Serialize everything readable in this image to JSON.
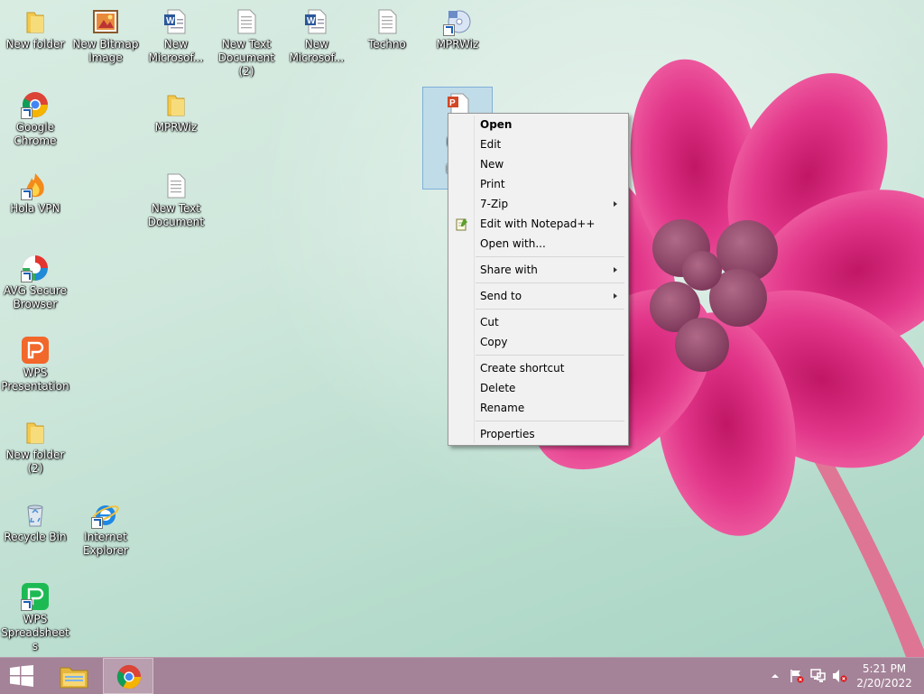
{
  "desktop": {
    "icons": [
      {
        "label": "New folder"
      },
      {
        "label": "New Bitmap Image"
      },
      {
        "label": "New Microsof..."
      },
      {
        "label": "New Text Document (2)"
      },
      {
        "label": "New Microsof..."
      },
      {
        "label": "Techno"
      },
      {
        "label": "MPRWiz"
      },
      {
        "label": "Google Chrome"
      },
      {
        "label": "MPRWiz"
      },
      {
        "label": "Hola VPN"
      },
      {
        "label": "New Text Document"
      },
      {
        "label": "AVG Secure Browser"
      },
      {
        "label": "WPS Presentation"
      },
      {
        "label": "New folder (2)"
      },
      {
        "label": "Recycle Bin"
      },
      {
        "label": "Internet Explorer"
      },
      {
        "label": "WPS Spreadsheets"
      }
    ],
    "selected_icon": {
      "label_lines": [
        "Mi",
        "Pow",
        "97",
        "Pres"
      ]
    }
  },
  "context_menu": {
    "items": [
      {
        "label": "Open"
      },
      {
        "label": "Edit"
      },
      {
        "label": "New"
      },
      {
        "label": "Print"
      },
      {
        "label": "7-Zip"
      },
      {
        "label": "Edit with Notepad++"
      },
      {
        "label": "Open with..."
      },
      {
        "label": "Share with"
      },
      {
        "label": "Send to"
      },
      {
        "label": "Cut"
      },
      {
        "label": "Copy"
      },
      {
        "label": "Create shortcut"
      },
      {
        "label": "Delete"
      },
      {
        "label": "Rename"
      },
      {
        "label": "Properties"
      }
    ]
  },
  "taskbar": {
    "clock": {
      "time": "5:21 PM",
      "date": "2/20/2022"
    }
  },
  "colors": {
    "taskbar": "#a48398",
    "menu_bg": "#f1f1f1",
    "flower": "#e0347f",
    "folder": "#f3c94e"
  }
}
